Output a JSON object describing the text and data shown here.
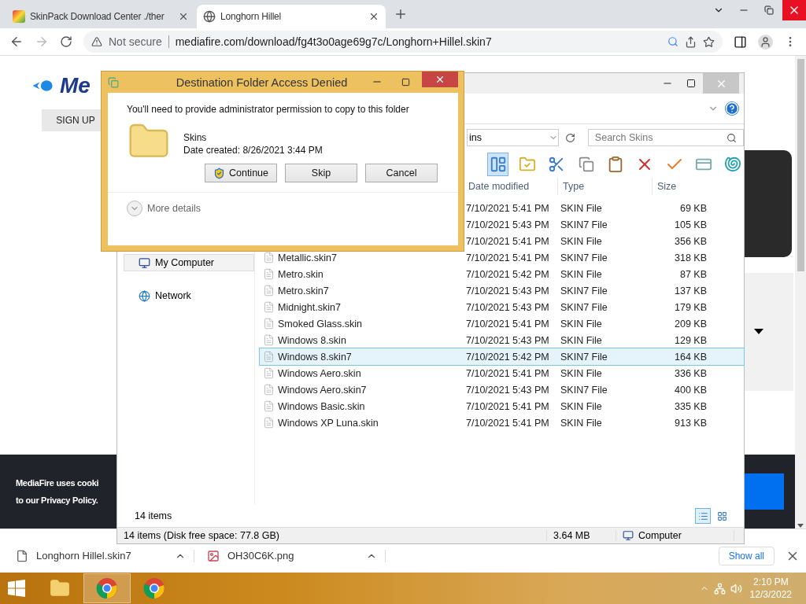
{
  "browser": {
    "tabs": [
      {
        "title": "SkinPack Download Center ./ther",
        "selected": false
      },
      {
        "title": "Longhorn Hillel",
        "selected": true
      }
    ],
    "security": "Not secure",
    "url": "mediafire.com/download/fg4t3o0age69g7c/Longhorn+Hillel.skin7"
  },
  "page": {
    "logo": "Me",
    "sign_up": "SIGN UP",
    "cookie_lines": [
      "MediaFire uses cooki",
      "to our Privacy Policy."
    ]
  },
  "downloads": {
    "items": [
      {
        "name": "Longhorn Hillel.skin7",
        "kind": "file"
      },
      {
        "name": "OH30C6K.png",
        "kind": "image"
      }
    ],
    "show_all": "Show all"
  },
  "explorer": {
    "address": "ins",
    "search_placeholder": "Search Skins",
    "toolbar": [
      {
        "kind": "layout",
        "pressed": true
      },
      {
        "kind": "properties",
        "pressed": false
      },
      {
        "kind": "cut",
        "pressed": false
      },
      {
        "kind": "copy",
        "pressed": false
      },
      {
        "kind": "paste",
        "pressed": false
      },
      {
        "kind": "delete",
        "pressed": false
      },
      {
        "kind": "check",
        "pressed": false
      },
      {
        "kind": "card",
        "pressed": false
      },
      {
        "kind": "shell",
        "pressed": false
      }
    ],
    "columns": [
      "Date modified",
      "Type",
      "Size"
    ],
    "nav": [
      {
        "label": "My Computer",
        "kind": "computer",
        "selected": true
      },
      {
        "label": "Network",
        "kind": "network",
        "selected": false
      }
    ],
    "rows": [
      {
        "date": "7/10/2021 5:41 PM",
        "type": "SKIN File",
        "size": "69 KB",
        "selected": false
      },
      {
        "date": "7/10/2021 5:43 PM",
        "type": "SKIN7 File",
        "size": "105 KB",
        "selected": false
      },
      {
        "date": "7/10/2021 5:41 PM",
        "type": "SKIN File",
        "size": "356 KB",
        "selected": false
      },
      {
        "name": "Metallic.skin7",
        "date": "7/10/2021 5:41 PM",
        "type": "SKIN7 File",
        "size": "318 KB",
        "selected": false
      },
      {
        "name": "Metro.skin",
        "date": "7/10/2021 5:42 PM",
        "type": "SKIN File",
        "size": "87 KB",
        "selected": false
      },
      {
        "name": "Metro.skin7",
        "date": "7/10/2021 5:43 PM",
        "type": "SKIN7 File",
        "size": "137 KB",
        "selected": false
      },
      {
        "name": "Midnight.skin7",
        "date": "7/10/2021 5:43 PM",
        "type": "SKIN7 File",
        "size": "179 KB",
        "selected": false
      },
      {
        "name": "Smoked Glass.skin",
        "date": "7/10/2021 5:41 PM",
        "type": "SKIN File",
        "size": "209 KB",
        "selected": false
      },
      {
        "name": "Windows 8.skin",
        "date": "7/10/2021 5:43 PM",
        "type": "SKIN File",
        "size": "129 KB",
        "selected": false
      },
      {
        "name": "Windows 8.skin7",
        "date": "7/10/2021 5:42 PM",
        "type": "SKIN7 File",
        "size": "164 KB",
        "selected": true
      },
      {
        "name": "Windows Aero.skin",
        "date": "7/10/2021 5:41 PM",
        "type": "SKIN File",
        "size": "336 KB",
        "selected": false
      },
      {
        "name": "Windows Aero.skin7",
        "date": "7/10/2021 5:43 PM",
        "type": "SKIN7 File",
        "size": "400 KB",
        "selected": false
      },
      {
        "name": "Windows Basic.skin",
        "date": "7/10/2021 5:41 PM",
        "type": "SKIN File",
        "size": "335 KB",
        "selected": false
      },
      {
        "name": "Windows XP Luna.skin",
        "date": "7/10/2021 5:41 PM",
        "type": "SKIN File",
        "size": "913 KB",
        "selected": false
      }
    ],
    "item_count": "14 items",
    "views": [
      {
        "kind": "details",
        "selected": true
      },
      {
        "kind": "tiles",
        "selected": false
      }
    ],
    "status": {
      "summary": "14 items (Disk free space: 77.8 GB)",
      "size": "3.64 MB",
      "location": "Computer"
    }
  },
  "dialog": {
    "title": "Destination Folder Access Denied",
    "message": "You'll need to provide administrator permission to copy to this folder",
    "folder_name": "Skins",
    "date_created": "Date created: 8/26/2021 3:44 PM",
    "buttons": [
      {
        "label": "Continue",
        "kind": "shield"
      },
      {
        "label": "Skip",
        "kind": "plain"
      },
      {
        "label": "Cancel",
        "kind": "plain"
      }
    ],
    "more_details": "More details"
  },
  "taskbar": {
    "apps": [
      {
        "kind": "explorer",
        "active": false
      },
      {
        "kind": "chrome",
        "active": true
      },
      {
        "kind": "chrome",
        "active": false
      }
    ],
    "time": "2:10 PM",
    "date": "12/3/2022"
  }
}
